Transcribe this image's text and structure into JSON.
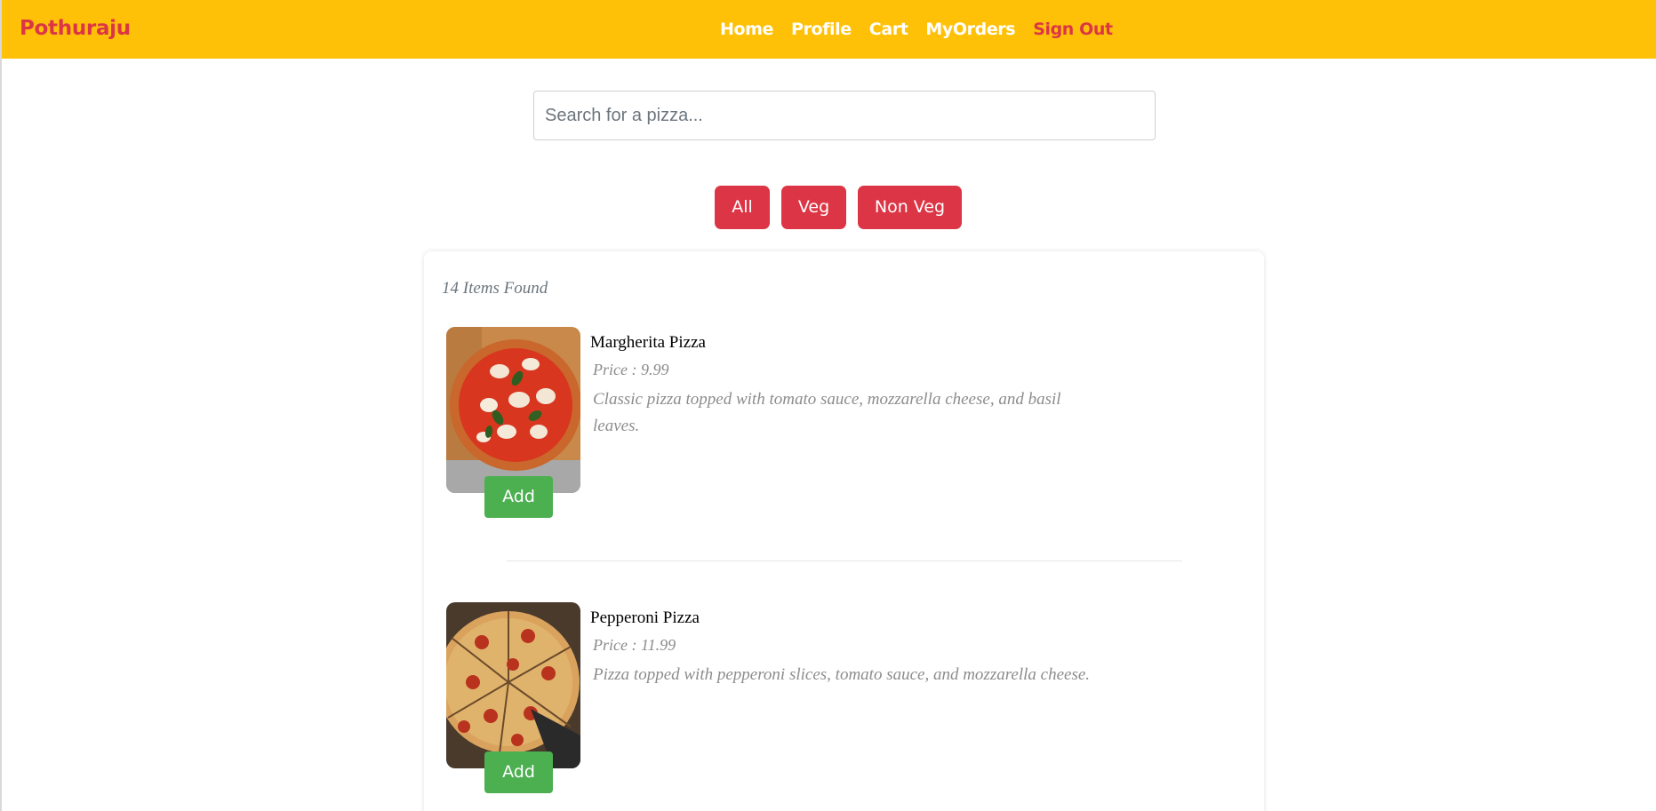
{
  "navbar": {
    "brand": "Pothuraju",
    "links": [
      "Home",
      "Profile",
      "Cart",
      "MyOrders"
    ],
    "signout": "Sign Out",
    "background": "#ffc107",
    "accent": "#dc3545"
  },
  "search": {
    "placeholder": "Search for a pizza...",
    "value": ""
  },
  "filters": [
    "All",
    "Veg",
    "Non Veg"
  ],
  "results": {
    "count_label": "14 Items Found",
    "items": [
      {
        "name": "Margherita Pizza",
        "price": "Price : 9.99",
        "description": "Classic pizza topped with tomato sauce, mozzarella cheese, and basil leaves.",
        "add_label": "Add",
        "image_icon": "margherita-pizza-image"
      },
      {
        "name": "Pepperoni Pizza",
        "price": "Price : 11.99",
        "description": "Pizza topped with pepperoni slices, tomato sauce, and mozzarella cheese.",
        "add_label": "Add",
        "image_icon": "pepperoni-pizza-image"
      }
    ]
  },
  "colors": {
    "filter_button": "#dc3545",
    "add_button": "#4caf50"
  }
}
